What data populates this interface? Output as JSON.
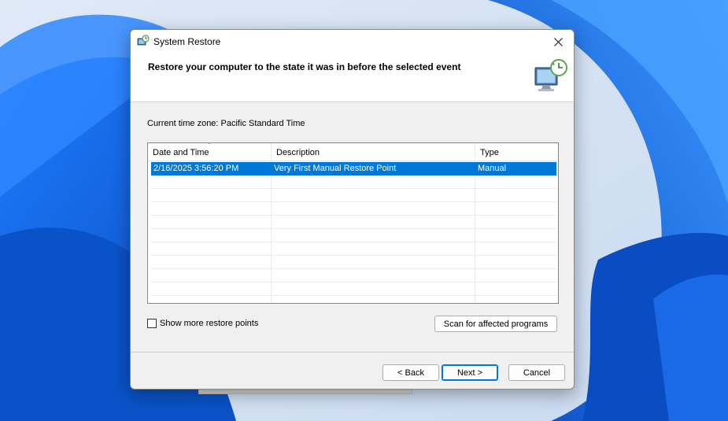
{
  "window": {
    "title": "System Restore",
    "close_glyph": "✕"
  },
  "header": {
    "heading": "Restore your computer to the state it was in before the selected event",
    "icon": "restore-computer-icon"
  },
  "timezone_text": "Current time zone: Pacific Standard Time",
  "table": {
    "columns": [
      "Date and Time",
      "Description",
      "Type"
    ],
    "sorted_column": "Date and Time",
    "rows": [
      {
        "date": "2/16/2025 3:56:20 PM",
        "description": "Very First Manual Restore Point",
        "type": "Manual",
        "selected": true
      }
    ]
  },
  "show_more": {
    "label": "Show more restore points",
    "checked": false
  },
  "buttons": {
    "scan": "Scan for affected programs",
    "back": "< Back",
    "next": "Next >",
    "cancel": "Cancel"
  },
  "colors": {
    "selection": "#0078d7",
    "wallpaper": "#0b5bd0"
  }
}
